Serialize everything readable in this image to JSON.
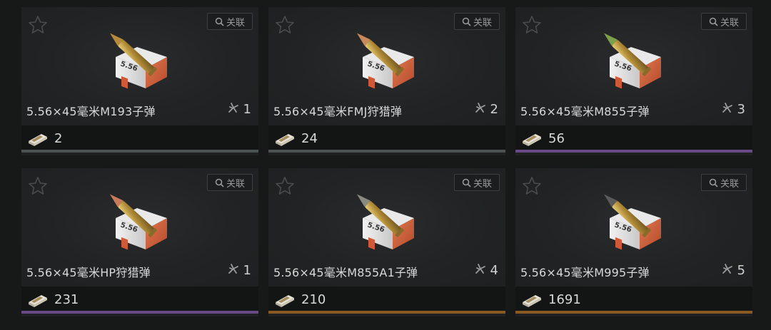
{
  "relate_label": "关联",
  "items": [
    {
      "name": "5.56×45毫米M193子弹",
      "tier": "1",
      "price": "2",
      "rarity_color": "#4c5152"
    },
    {
      "name": "5.56×45毫米FMJ狩猎弹",
      "tier": "2",
      "price": "24",
      "rarity_color": "#4c5152"
    },
    {
      "name": "5.56×45毫米M855子弹",
      "tier": "3",
      "price": "56",
      "rarity_color": "#6a4a86"
    },
    {
      "name": "5.56×45毫米HP狩猎弹",
      "tier": "1",
      "price": "231",
      "rarity_color": "#6a4a86"
    },
    {
      "name": "5.56×45毫米M855A1子弹",
      "tier": "4",
      "price": "210",
      "rarity_color": "#8a5a22"
    },
    {
      "name": "5.56×45毫米M995子弹",
      "tier": "5",
      "price": "1691",
      "rarity_color": "#8a5a22"
    }
  ],
  "icons": {
    "favorite": "star-outline-icon",
    "relate": "search-icon",
    "tier": "armor-pen-icon",
    "price": "cash-stack-icon",
    "item": "ammo-box-icon"
  }
}
